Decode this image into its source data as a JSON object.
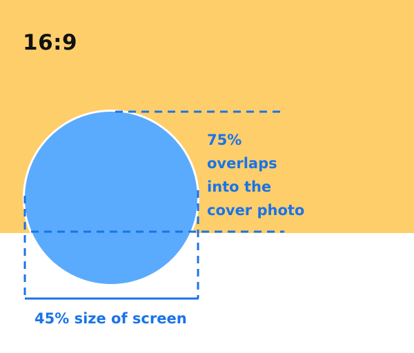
{
  "aspect_label": "16:9",
  "overlap_note": {
    "lines": [
      "75%",
      "overlaps",
      "into the",
      "cover photo"
    ]
  },
  "size_caption": "45% size of screen",
  "colors": {
    "cover_background": "#FECE6A",
    "page_background": "#FFFFFF",
    "avatar_circle": "#5AABFD",
    "annotation_blue": "#1A73E8",
    "label_dark": "#111111"
  },
  "annotations": {
    "overlap_percent": 75,
    "size_percent_of_screen": 45
  }
}
